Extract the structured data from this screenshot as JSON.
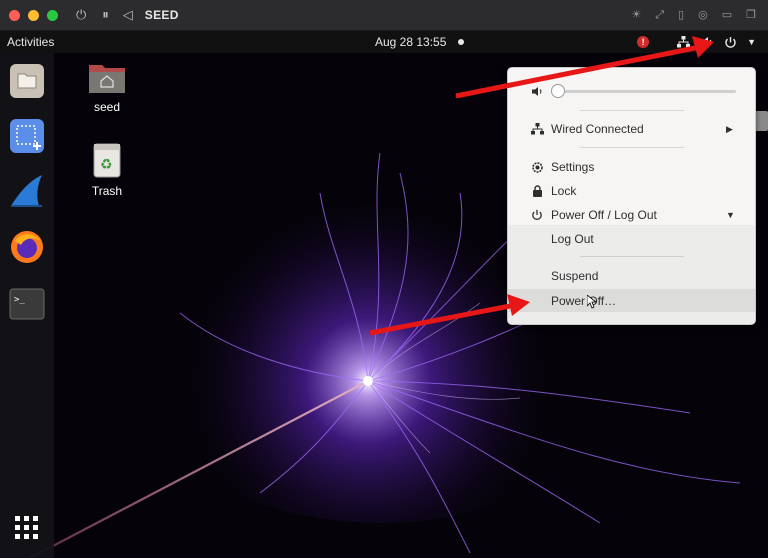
{
  "host_window": {
    "title": "SEED",
    "traffic_colors": [
      "#ff5f57",
      "#febc2e",
      "#28c840"
    ]
  },
  "top_bar": {
    "activities": "Activities",
    "clock": "Aug 28  13:55"
  },
  "desktop_icons": [
    {
      "label": "seed"
    },
    {
      "label": "Trash"
    }
  ],
  "menu": {
    "wired": "Wired Connected",
    "settings": "Settings",
    "lock": "Lock",
    "power": "Power Off / Log Out",
    "logout": "Log Out",
    "suspend": "Suspend",
    "poweroff": "Power Off…"
  },
  "colors": {
    "accent_arrow": "#e81717",
    "menu_bg": "#f6f5f4",
    "highlight": "#dcdcdb"
  }
}
